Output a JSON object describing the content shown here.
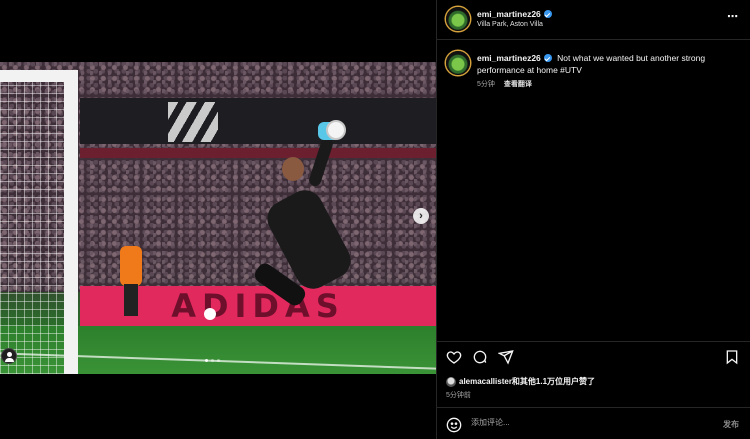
{
  "post": {
    "username": "emi_martinez26",
    "location": "Villa Park, Aston Villa",
    "more_icon": "⋯"
  },
  "media": {
    "ad_board_text": "ADIDAS",
    "carousel_next_glyph": "›",
    "carousel": {
      "total": 3,
      "active": 1
    }
  },
  "caption": {
    "username": "emi_martinez26",
    "text": "Not what we wanted but another strong performance at home #UTV",
    "time": "5分钟",
    "translate_label": "查看翻译"
  },
  "engagement": {
    "likes_text": "alemacallister和其他1.1万位用户赞了",
    "posted_ago": "5分钟前"
  },
  "comment": {
    "placeholder": "添加评论...",
    "post_label": "发布"
  },
  "icons": [
    "heart-icon",
    "comment-icon",
    "share-icon",
    "bookmark-icon",
    "emoji-icon",
    "verified-badge-icon",
    "user-tag-icon",
    "more-icon"
  ],
  "colors": {
    "verified": "#3897f0",
    "background": "#000000",
    "divider": "#262626",
    "muted_text": "#a8a8a8"
  }
}
